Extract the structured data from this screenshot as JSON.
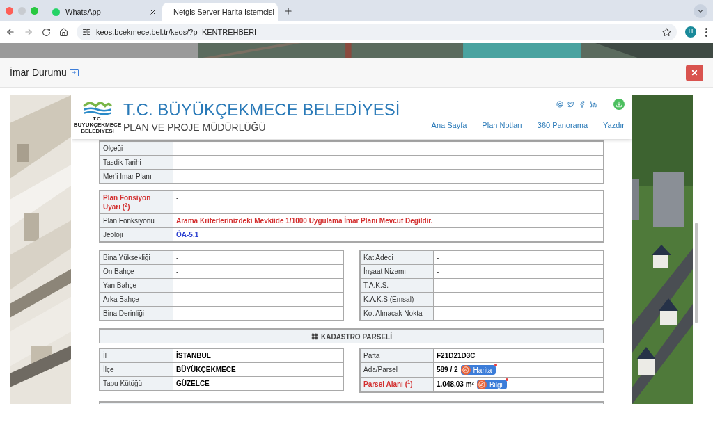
{
  "browser": {
    "tabs": [
      {
        "title": "WhatsApp",
        "kind": "whatsapp",
        "selected": false
      },
      {
        "title": "Netgis Server Harita İstemcisi",
        "kind": "netgis",
        "selected": true
      }
    ],
    "url": "keos.bcekmece.bel.tr/keos/?p=KENTREHBERI",
    "profile": "H"
  },
  "modal": {
    "title": "İmar Durumu"
  },
  "header": {
    "logo_text": [
      "T.C.",
      "BÜYÜKÇEKMECE",
      "BELEDİYESİ"
    ],
    "title": "T.C. BÜYÜKÇEKMECE BELEDİYESİ",
    "subtitle": "PLAN VE PROJE MÜDÜRLÜĞÜ",
    "nav": [
      "Ana Sayfa",
      "Plan Notları",
      "360 Panorama",
      "Yazdır"
    ]
  },
  "plan_rows": [
    {
      "label": "Ölçeği",
      "value": "-",
      "warning": false
    },
    {
      "label": "Tasdik Tarihi",
      "value": "-",
      "warning": false
    },
    {
      "label": "Mer'i İmar Planı",
      "value": "-",
      "warning": false
    }
  ],
  "plan_rows_2": [
    {
      "label": "Plan Fonsiyon Uyarı ($^{2}$)",
      "value": "-",
      "warning": true
    },
    {
      "label": "Plan Fonksiyonu",
      "value": "Arama Kriterlerinizdeki Mevkiide 1/1000 Uygulama İmar Planı Mevcut Değildir.",
      "warning": false,
      "kind": "alert"
    },
    {
      "label": "Jeoloji",
      "value": "ÖA-5.1",
      "warning": false,
      "kind": "link"
    }
  ],
  "building_left": [
    {
      "label": "Bina Yüksekliği",
      "value": "-"
    },
    {
      "label": "Ön Bahçe",
      "value": "-"
    },
    {
      "label": "Yan Bahçe",
      "value": "-"
    },
    {
      "label": "Arka Bahçe",
      "value": "-"
    },
    {
      "label": "Bina Derinliği",
      "value": "-"
    }
  ],
  "building_right": [
    {
      "label": "Kat Adedi",
      "value": "-"
    },
    {
      "label": "İnşaat Nizamı",
      "value": "-"
    },
    {
      "label": "T.A.K.S.",
      "value": "-"
    },
    {
      "label": "K.A.K.S (Emsal)",
      "value": "-"
    },
    {
      "label": "Kot Alınacak Nokta",
      "value": "-"
    }
  ],
  "kadastro": {
    "title": "KADASTRO PARSELİ",
    "left": [
      {
        "label": "İl",
        "value": "İSTANBUL"
      },
      {
        "label": "İlçe",
        "value": "BÜYÜKÇEKMECE"
      },
      {
        "label": "Tapu Kütüğü",
        "value": "GÜZELCE"
      }
    ],
    "right": [
      {
        "label": "Pafta",
        "value": "F21D21D3C",
        "warning": false
      },
      {
        "label": "Ada/Parsel",
        "value": "589 / 2",
        "warning": false,
        "badge": "Harita"
      },
      {
        "label": "Parsel Alanı ($^{1}$)",
        "value": "1.048,03 m²",
        "warning": true,
        "badge": "Bilgi"
      }
    ]
  }
}
